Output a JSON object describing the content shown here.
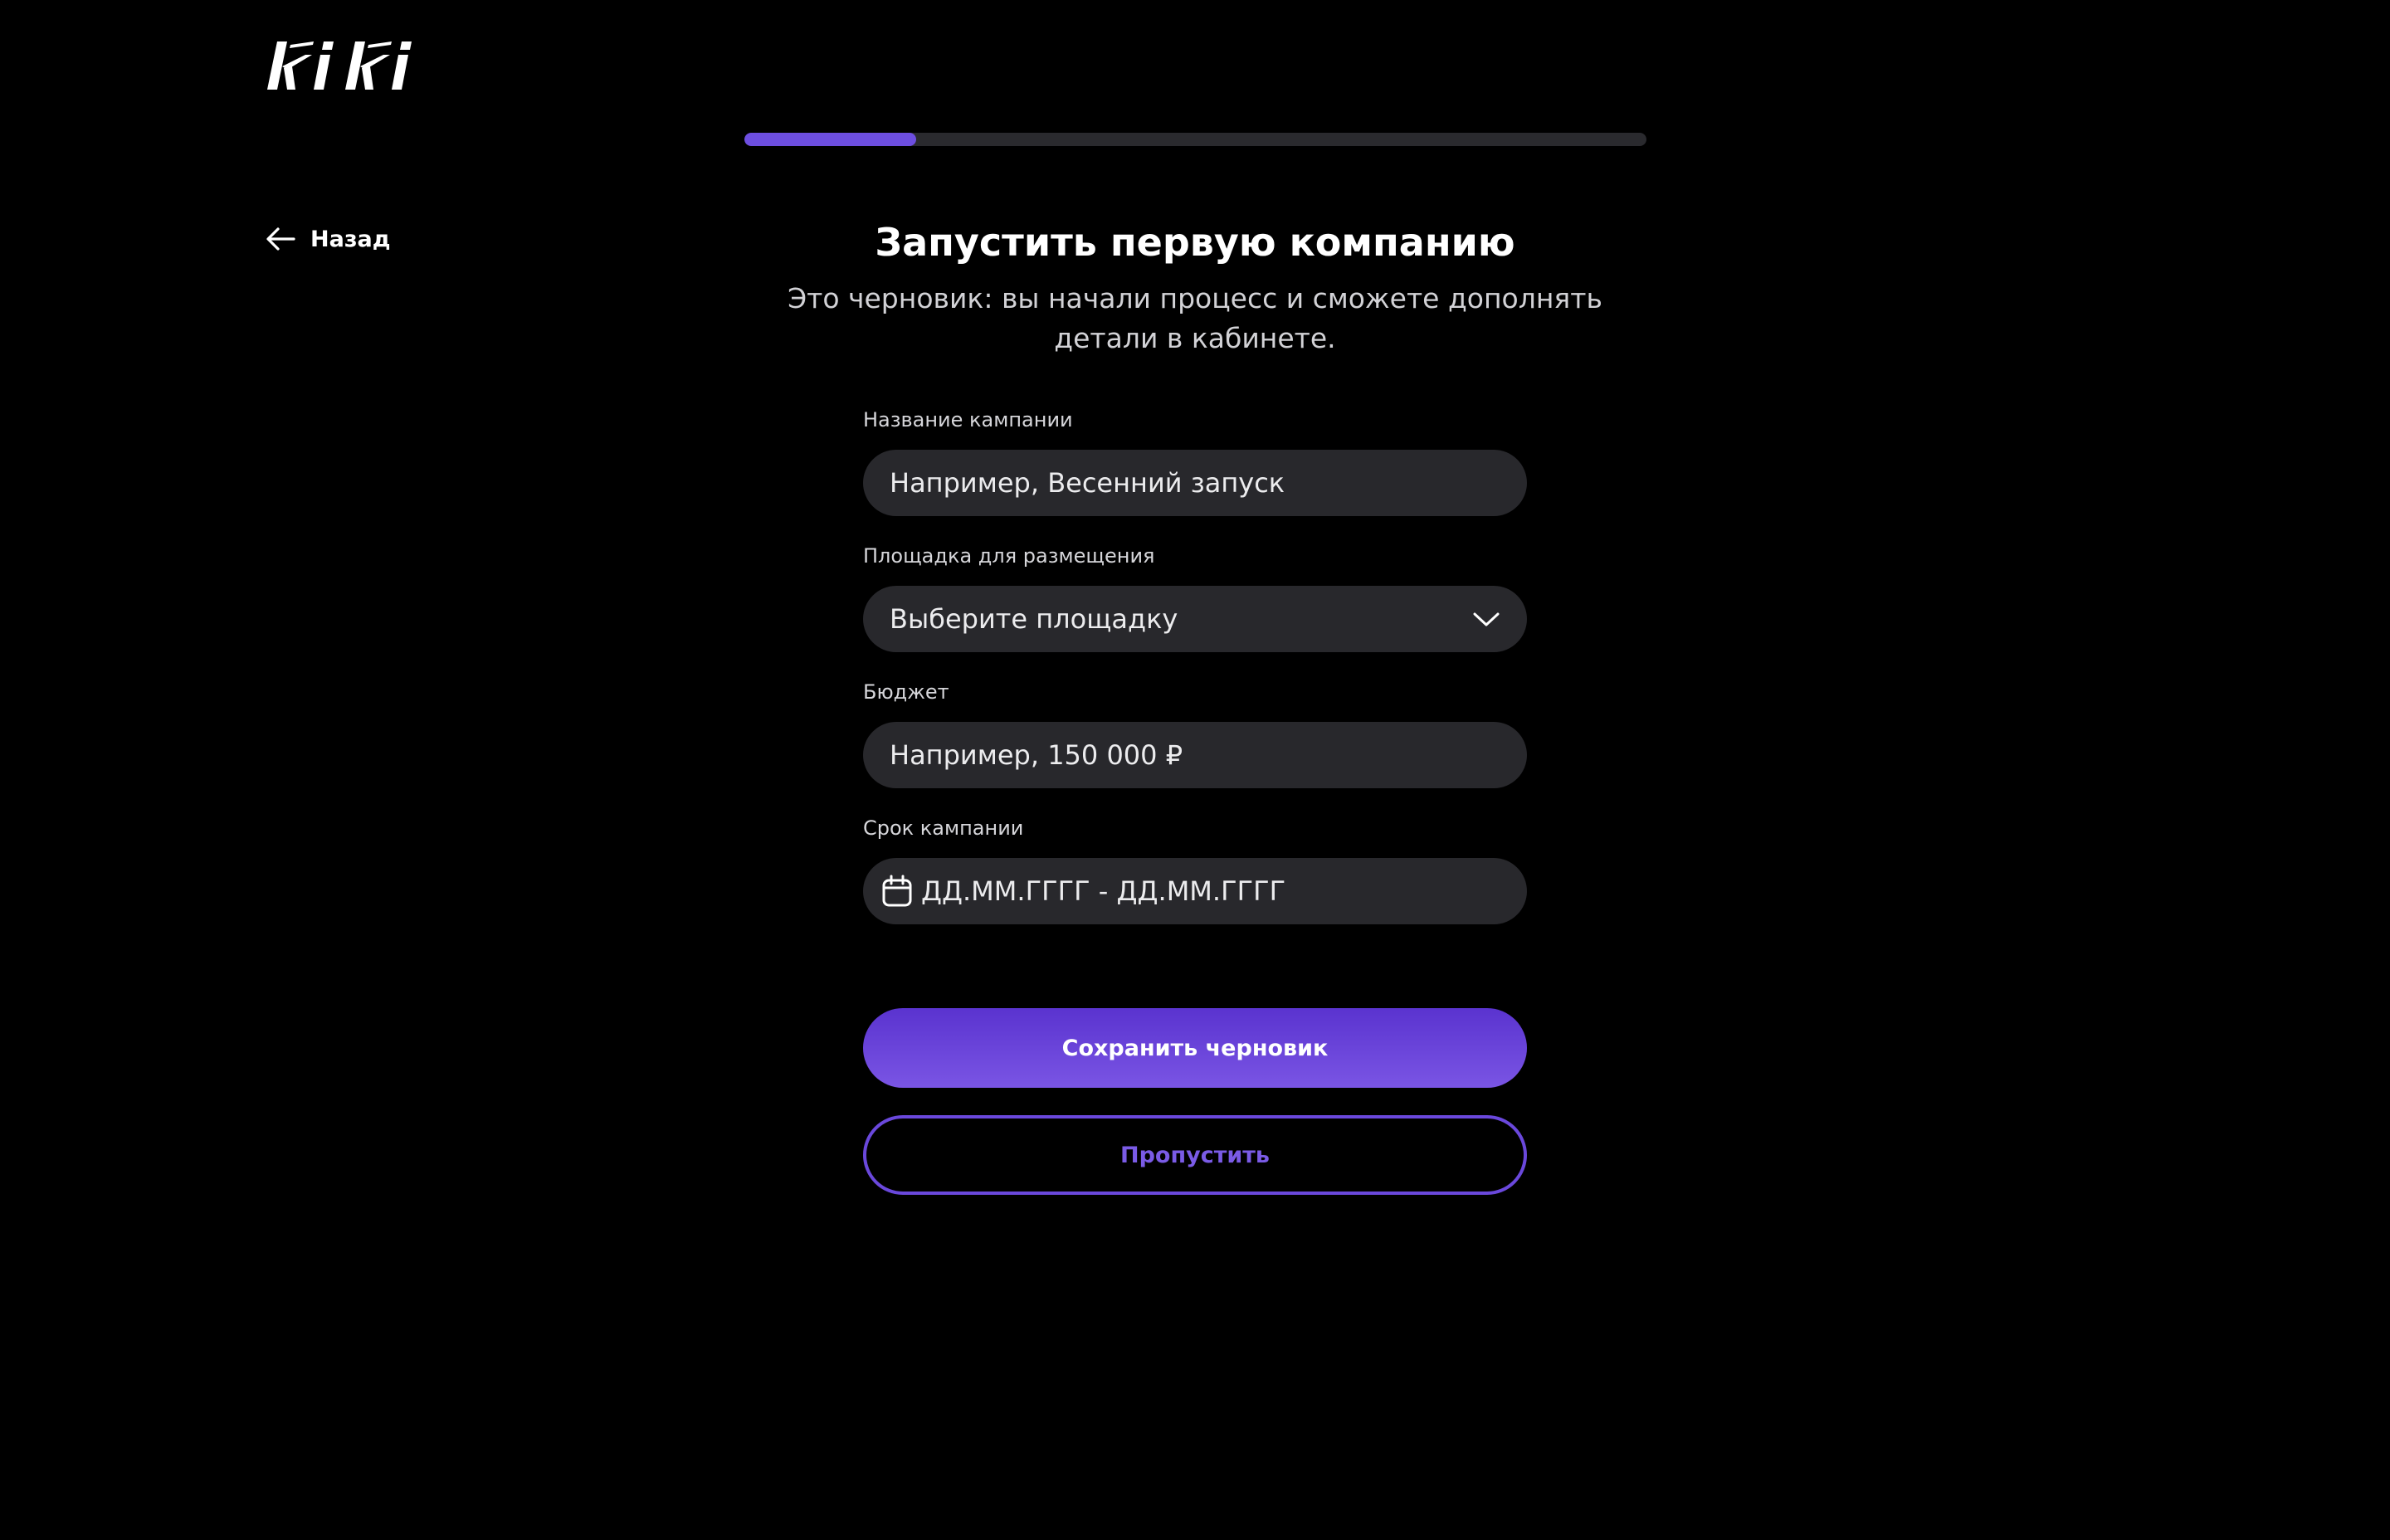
{
  "brand": {
    "logo_text": "kiki",
    "accent_color": "#6d4ee0"
  },
  "progress": {
    "percent": 19
  },
  "nav": {
    "back_label": "Назад",
    "back_icon": "arrow-left-icon"
  },
  "header": {
    "title": "Запустить первую компанию",
    "subtitle": "Это черновик: вы начали процесс и сможете дополнять детали в кабинете."
  },
  "form": {
    "campaign_name": {
      "label": "Название кампании",
      "placeholder": "Например, Весенний запуск",
      "value": ""
    },
    "platform": {
      "label": "Площадка для размещения",
      "selected": "Выберите площадку",
      "icon": "chevron-down-icon"
    },
    "budget": {
      "label": "Бюджет",
      "placeholder": "Например, 150 000 ₽",
      "value": ""
    },
    "period": {
      "label": "Срок кампании",
      "placeholder": "ДД.ММ.ГГГГ - ДД.ММ.ГГГГ",
      "value": "",
      "icon": "calendar-icon"
    }
  },
  "actions": {
    "save_label": "Сохранить черновик",
    "skip_label": "Пропустить"
  }
}
